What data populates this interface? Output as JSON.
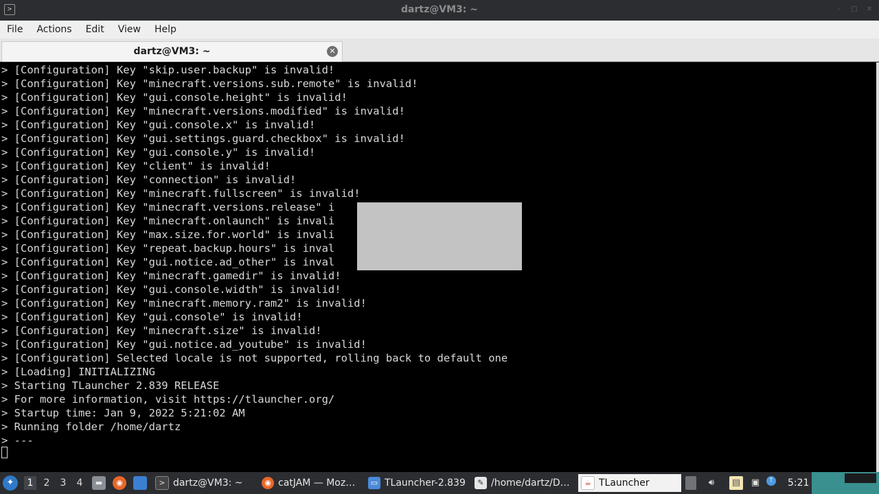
{
  "window": {
    "title": "dartz@VM3: ~",
    "app_icon": "terminal-icon",
    "controls": [
      "minimize-icon",
      "maximize-icon",
      "close-icon"
    ]
  },
  "menu": [
    "File",
    "Actions",
    "Edit",
    "View",
    "Help"
  ],
  "tab": {
    "label": "dartz@VM3: ~",
    "close_icon": "close-circle-icon"
  },
  "terminal": {
    "lines": [
      "> [Configuration] Key \"skip.user.backup\" is invalid!",
      "> [Configuration] Key \"minecraft.versions.sub.remote\" is invalid!",
      "> [Configuration] Key \"gui.console.height\" is invalid!",
      "> [Configuration] Key \"minecraft.versions.modified\" is invalid!",
      "> [Configuration] Key \"gui.console.x\" is invalid!",
      "> [Configuration] Key \"gui.settings.guard.checkbox\" is invalid!",
      "> [Configuration] Key \"gui.console.y\" is invalid!",
      "> [Configuration] Key \"client\" is invalid!",
      "> [Configuration] Key \"connection\" is invalid!",
      "> [Configuration] Key \"minecraft.fullscreen\" is invalid!",
      "> [Configuration] Key \"minecraft.versions.release\" i",
      "> [Configuration] Key \"minecraft.onlaunch\" is invali",
      "> [Configuration] Key \"max.size.for.world\" is invali",
      "> [Configuration] Key \"repeat.backup.hours\" is inval",
      "> [Configuration] Key \"gui.notice.ad_other\" is inval",
      "> [Configuration] Key \"minecraft.gamedir\" is invalid!",
      "> [Configuration] Key \"gui.console.width\" is invalid!",
      "> [Configuration] Key \"minecraft.memory.ram2\" is invalid!",
      "> [Configuration] Key \"gui.console\" is invalid!",
      "> [Configuration] Key \"minecraft.size\" is invalid!",
      "> [Configuration] Key \"gui.notice.ad_youtube\" is invalid!",
      "> [Configuration] Selected locale is not supported, rolling back to default one",
      "> [Loading] INITIALIZING",
      "> Starting TLauncher 2.839 RELEASE",
      "> For more information, visit https://tlauncher.org/",
      "> Startup time: Jan 9, 2022 5:21:02 AM",
      "> Running folder /home/dartz",
      "> ---"
    ]
  },
  "taskbar": {
    "start_icon": "start-menu-icon",
    "workspaces": [
      "1",
      "2",
      "3",
      "4"
    ],
    "active_workspace": "1",
    "quicklaunch": [
      "file-manager-icon",
      "firefox-icon",
      "show-desktop-icon"
    ],
    "tasks": [
      {
        "label": "dartz@VM3: ~",
        "icon": "terminal-icon"
      },
      {
        "label": "catJAM — Moz…",
        "icon": "firefox-icon"
      },
      {
        "label": "TLauncher-2.839",
        "icon": "folder-icon"
      },
      {
        "label": "/home/dartz/D…",
        "icon": "text-editor-icon"
      },
      {
        "label": "TLauncher",
        "icon": "java-icon"
      }
    ],
    "active_task": "TLauncher",
    "tray": [
      "clipboard-icon",
      "volume-icon",
      "notes-icon",
      "network-icon",
      "update-icon"
    ],
    "clock": "5:21"
  },
  "colors": {
    "titlebar": "#2b2d31",
    "menubar": "#efefef",
    "terminal_bg": "#000000",
    "terminal_fg": "#d8d8d8",
    "taskbar": "#2b2d31",
    "desktop_accent": "#3a8f8f"
  }
}
